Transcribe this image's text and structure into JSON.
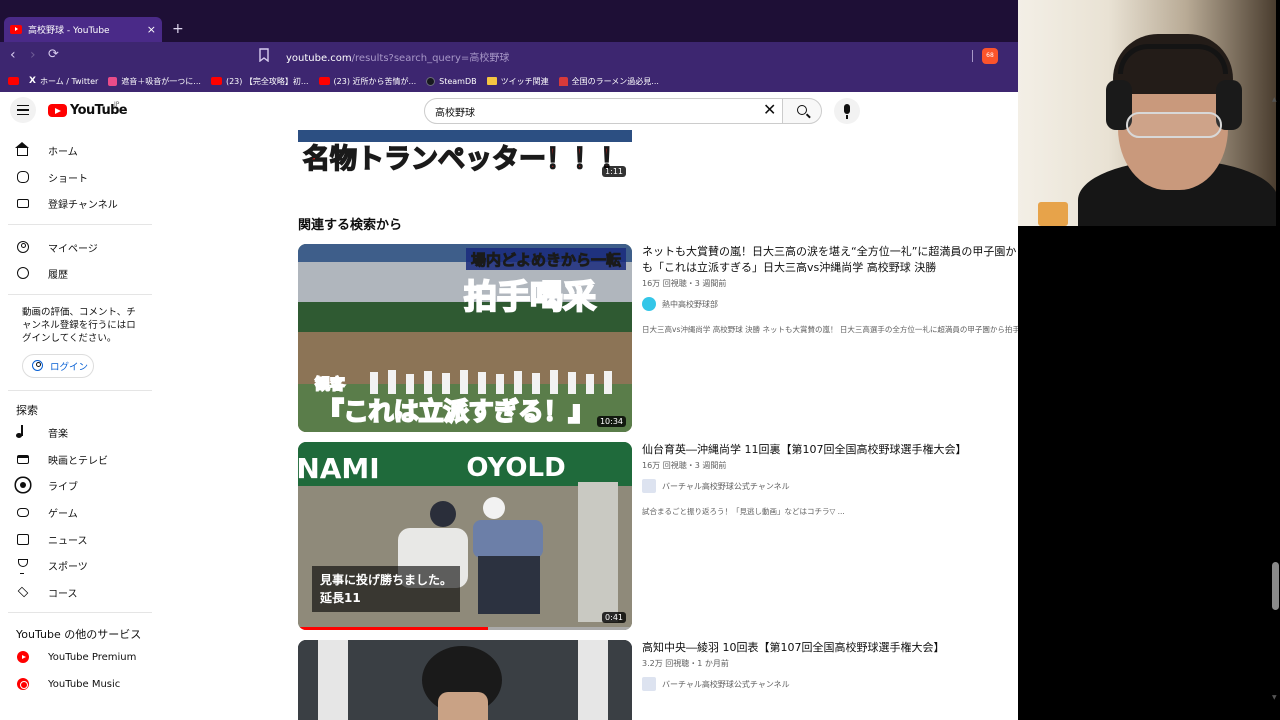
{
  "browser": {
    "tab_title": "高校野球 - YouTube",
    "tab_close": "×",
    "new_tab": "+",
    "back": "‹",
    "forward": "›",
    "reload": "⟳",
    "url_host": "youtube.com",
    "url_path": "/results?search_query=高校野球",
    "brave_badge": "68",
    "bookmarks": [
      {
        "label": "",
        "icon": "youtube-icon"
      },
      {
        "label": "ホーム / Twitter",
        "icon": "x-icon"
      },
      {
        "label": "遮音＋吸音が一つに...",
        "icon": "site-icon"
      },
      {
        "label": "(23) 【完全攻略】初...",
        "icon": "youtube-icon"
      },
      {
        "label": "(23) 近所から苦情が...",
        "icon": "youtube-icon"
      },
      {
        "label": "SteamDB",
        "icon": "steamdb-icon"
      },
      {
        "label": "ツイッチ関連",
        "icon": "folder-icon"
      },
      {
        "label": "全国のラーメン過必見...",
        "icon": "ramen-icon"
      }
    ]
  },
  "masthead": {
    "logo_text": "YouTube",
    "logo_region": "JP",
    "search_value": "高校野球",
    "clear": "✕"
  },
  "sidebar": {
    "primary": [
      {
        "label": "ホーム",
        "icon": "home-icon"
      },
      {
        "label": "ショート",
        "icon": "shorts-icon"
      },
      {
        "label": "登録チャンネル",
        "icon": "subscriptions-icon"
      }
    ],
    "you": [
      {
        "label": "マイページ",
        "icon": "account-icon"
      },
      {
        "label": "履歴",
        "icon": "history-icon"
      }
    ],
    "signin_note": "動画の評価、コメント、チャンネル登録を行うにはログインしてください。",
    "login_label": "ログイン",
    "explore_heading": "探索",
    "explore": [
      {
        "label": "音楽",
        "icon": "music-icon"
      },
      {
        "label": "映画とテレビ",
        "icon": "movies-icon"
      },
      {
        "label": "ライブ",
        "icon": "live-icon"
      },
      {
        "label": "ゲーム",
        "icon": "gaming-icon"
      },
      {
        "label": "ニュース",
        "icon": "news-icon"
      },
      {
        "label": "スポーツ",
        "icon": "sports-icon"
      },
      {
        "label": "コース",
        "icon": "courses-icon"
      }
    ],
    "more_heading": "YouTube の他のサービス",
    "more": [
      {
        "label": "YouTube Premium",
        "icon": "youtube-premium-icon"
      },
      {
        "label": "YouTube Music",
        "icon": "youtube-music-icon"
      }
    ]
  },
  "results": {
    "top_thumb_text": "名物トランペッター！！！",
    "top_duration": "1:11",
    "section_title": "関連する検索から",
    "videos": [
      {
        "title": "ネットも大賞賛の嵐！日大三高の涙を堪え“全方位一礼”に超満員の甲子園から拍手喝采！観客も「これは立派すぎる」日大三高vs沖縄尚学 高校野球 決勝",
        "meta": "16万 回視聴・3 週間前",
        "channel": "熱中高校野球部",
        "desc": "日大三高vs沖縄尚学 高校野球 決勝 ネットも大賞賛の嵐！ 日大三高選手の全方位一礼に超満員の甲子園から拍手喝采！観客も「 ...",
        "duration": "10:34",
        "thumb_top": "場内どよめきから一転",
        "thumb_main": "拍手喝采",
        "thumb_sub1": "観客",
        "thumb_sub2": "『これは立派すぎる！』"
      },
      {
        "title": "仙台育英―沖縄尚学 11回裏【第107回全国高校野球選手権大会】",
        "meta": "16万 回視聴・3 週間前",
        "channel": "バーチャル高校野球公式チャンネル",
        "desc": "試合まるごと振り返ろう！「見逃し動画」などはコチラ▽ ...",
        "duration": "0:41",
        "thumb_caption1": "見事に投げ勝ちました。",
        "thumb_caption2": "延長11",
        "thumb_banner": "NAMI",
        "thumb_banner2": "OYOLD",
        "progress": 0.57
      },
      {
        "title": "高知中央―綾羽 10回表【第107回全国高校野球選手権大会】",
        "meta": "3.2万 回視聴・1 か月前",
        "channel": "バーチャル高校野球公式チャンネル"
      }
    ]
  },
  "colors": {
    "youtube_red": "#ff0000",
    "browser_purple": "#3d2670",
    "link_blue": "#065fd4"
  }
}
